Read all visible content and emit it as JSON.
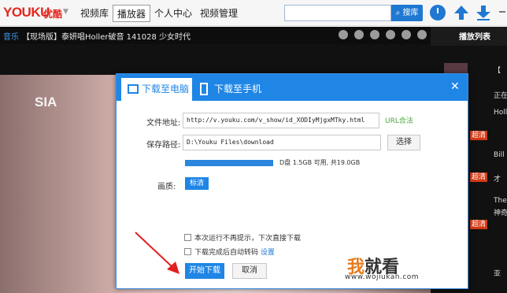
{
  "topbar": {
    "logo": "YOUKU",
    "logo_cn": "优酷",
    "nav": [
      "视频库",
      "播放器",
      "个人中心",
      "视频管理"
    ],
    "active_nav": "播放器",
    "search_placeholder": "",
    "search_button": "搜库"
  },
  "player": {
    "category": "音乐",
    "title": "【现场版】泰妍唱Holler破音 141028 少女时代",
    "watermark_logo": "SIA"
  },
  "playlist": {
    "header": "播放列表",
    "badges": [
      "超清",
      "超清",
      "超清"
    ],
    "side_texts": [
      "【",
      "正在",
      "Holl",
      "Bill",
      "才",
      "The",
      "神奇",
      "亚"
    ]
  },
  "dialog": {
    "tabs": [
      "下载至电脑",
      "下载至手机"
    ],
    "url_label": "文件地址:",
    "url_value": "http://v.youku.com/v_show/id_XODIyMjgxMTky.html",
    "url_status": "URL合法",
    "path_label": "保存路径:",
    "path_value": "D:\\Youku Files\\download",
    "browse_button": "选择",
    "disk_info": "D盘 1.5GB 可用, 共19.0GB",
    "disk_used_fraction": 0.92,
    "quality_label": "画质:",
    "quality_value": "标清",
    "checkbox_no_prompt": "本次运行不再提示，下次直接下载",
    "checkbox_transcode": "下载完成后自动转码",
    "transcode_link": "设置",
    "start_button": "开始下载",
    "cancel_button": "取消"
  },
  "watermark": {
    "text_brand": "我",
    "text_rest": "就看",
    "url": "www.wojiukan.com"
  },
  "colors": {
    "accent": "#1f86e6",
    "brand_red": "#e4261e",
    "ok_green": "#4aa83c",
    "watermark_orange": "#e87a1e"
  }
}
